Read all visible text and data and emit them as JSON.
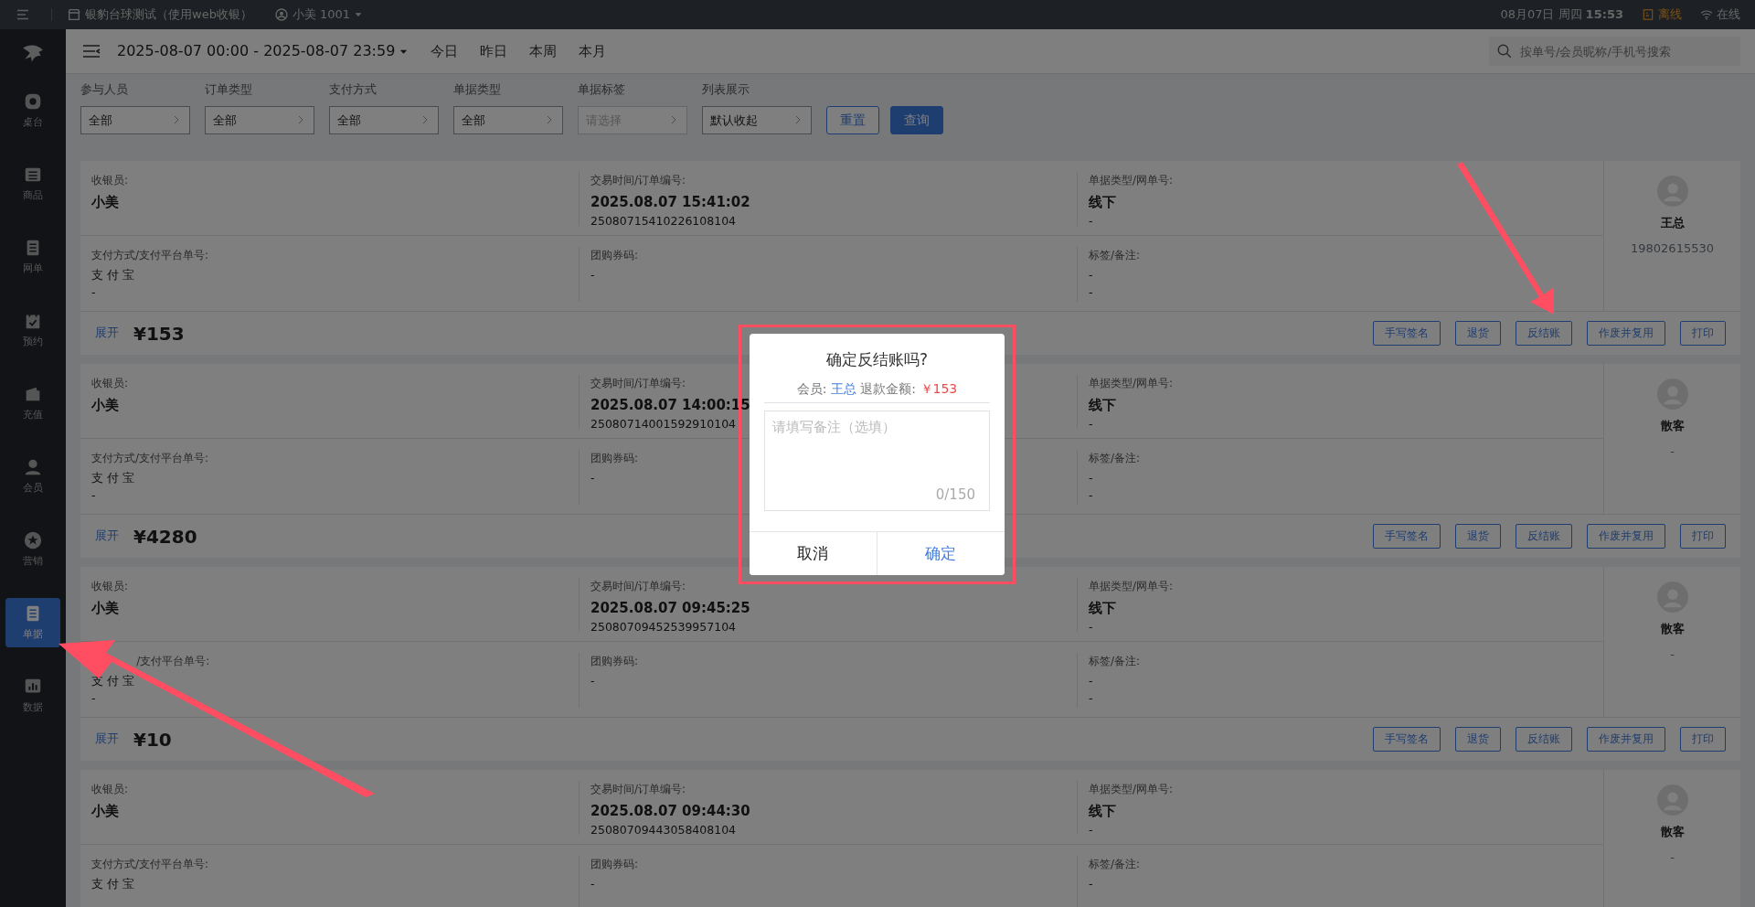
{
  "top_bar": {
    "store": "银豹台球测试（使用web收银）",
    "user": "小美 1001",
    "date": "08月07日 周四",
    "time": "15:53",
    "offline": "离线",
    "online": "在线"
  },
  "sidebar": {
    "items": [
      {
        "label": "桌台",
        "selected": false
      },
      {
        "label": "商品",
        "selected": false
      },
      {
        "label": "网单",
        "selected": false
      },
      {
        "label": "预约",
        "selected": false
      },
      {
        "label": "充值",
        "selected": false
      },
      {
        "label": "会员",
        "selected": false
      },
      {
        "label": "营销",
        "selected": false
      },
      {
        "label": "单据",
        "selected": true
      },
      {
        "label": "数据",
        "selected": false
      }
    ]
  },
  "header": {
    "date_range": "2025-08-07 00:00 - 2025-08-07 23:59",
    "quick_ranges": [
      "今日",
      "昨日",
      "本周",
      "本月"
    ],
    "search": {
      "placeholder": "按单号/会员昵称/手机号搜索"
    }
  },
  "filters": [
    {
      "label": "参与人员",
      "value": "全部"
    },
    {
      "label": "订单类型",
      "value": "全部"
    },
    {
      "label": "支付方式",
      "value": "全部"
    },
    {
      "label": "单据类型",
      "value": "全部"
    },
    {
      "label": "单据标签",
      "placeholder": "请选择"
    },
    {
      "label": "列表展示",
      "value": "默认收起"
    }
  ],
  "filter_buttons": [
    {
      "label": "重置",
      "kind": "outline"
    },
    {
      "label": "查询",
      "kind": "primary"
    }
  ],
  "orders": [
    {
      "fields": [
        {
          "label": "收银员:",
          "lines": [
            "小美"
          ]
        },
        {
          "label": "交易时间/订单编号:",
          "lines": [
            "2025.08.07 15:41:02",
            "25080715410226108104"
          ]
        },
        {
          "label": "单据类型/网单号:",
          "lines": [
            "线下",
            "-"
          ]
        },
        {
          "label": "支付方式/支付平台单号:",
          "lines": [
            "支 付 宝",
            "-"
          ]
        },
        {
          "label": "团购券码:",
          "lines": [
            "-"
          ]
        },
        {
          "label": "标签/备注:",
          "lines": [
            "-",
            "-"
          ]
        }
      ],
      "member_name": "王总",
      "member_phone": "19802615530",
      "expand": "展开",
      "amount": "¥153",
      "actions": [
        "手写签名",
        "退货",
        "反结账",
        "作废并复用",
        "打印"
      ]
    },
    {
      "fields": [
        {
          "label": "收银员:",
          "lines": [
            "小美"
          ]
        },
        {
          "label": "交易时间/订单编号:",
          "lines": [
            "2025.08.07 14:00:15",
            "25080714001592910104"
          ]
        },
        {
          "label": "单据类型/网单号:",
          "lines": [
            "线下",
            "-"
          ]
        },
        {
          "label": "支付方式/支付平台单号:",
          "lines": [
            "支 付 宝",
            "-"
          ]
        },
        {
          "label": "团购券码:",
          "lines": [
            "-"
          ]
        },
        {
          "label": "标签/备注:",
          "lines": [
            "-",
            "-"
          ]
        }
      ],
      "member_name": "散客",
      "member_phone": "-",
      "expand": "展开",
      "amount": "¥4280",
      "actions": [
        "手写签名",
        "退货",
        "反结账",
        "作废并复用",
        "打印"
      ]
    },
    {
      "fields": [
        {
          "label": "收银员:",
          "lines": [
            "小美"
          ]
        },
        {
          "label": "交易时间/订单编号:",
          "lines": [
            "2025.08.07 09:45:25",
            "25080709452539957104"
          ]
        },
        {
          "label": "单据类型/网单号:",
          "lines": [
            "线下",
            "-"
          ]
        },
        {
          "label": "/支付平台单号:",
          "kind": "covered",
          "lines": [
            "支 付 宝",
            "-"
          ]
        },
        {
          "label": "团购券码:",
          "lines": [
            "-"
          ]
        },
        {
          "label": "标签/备注:",
          "lines": [
            "-",
            "-"
          ]
        }
      ],
      "member_name": "散客",
      "member_phone": "-",
      "expand": "展开",
      "amount": "¥10",
      "actions": [
        "手写签名",
        "退货",
        "反结账",
        "作废并复用",
        "打印"
      ]
    },
    {
      "fields": [
        {
          "label": "收银员:",
          "lines": [
            "小美"
          ]
        },
        {
          "label": "交易时间/订单编号:",
          "lines": [
            "2025.08.07 09:44:30",
            "25080709443058408104"
          ]
        },
        {
          "label": "单据类型/网单号:",
          "lines": [
            "线下",
            "-"
          ]
        },
        {
          "label": "支付方式/支付平台单号:",
          "lines": [
            "支 付 宝"
          ]
        },
        {
          "label": "团购券码:",
          "lines": [
            "-"
          ]
        },
        {
          "label": "标签/备注:",
          "lines": [
            "-"
          ]
        }
      ],
      "member_name": "散客",
      "member_phone": "-"
    }
  ],
  "dialog": {
    "title": "确定反结账吗?",
    "member_label": "会员:",
    "member": "王总",
    "refund_label": "退款金额:",
    "refund": "￥153",
    "note": {
      "placeholder": "请填写备注（选填）"
    },
    "counter": "0/150",
    "buttons": [
      {
        "label": "取消",
        "kind": "cancel"
      },
      {
        "label": "确定",
        "kind": "confirm"
      }
    ]
  }
}
